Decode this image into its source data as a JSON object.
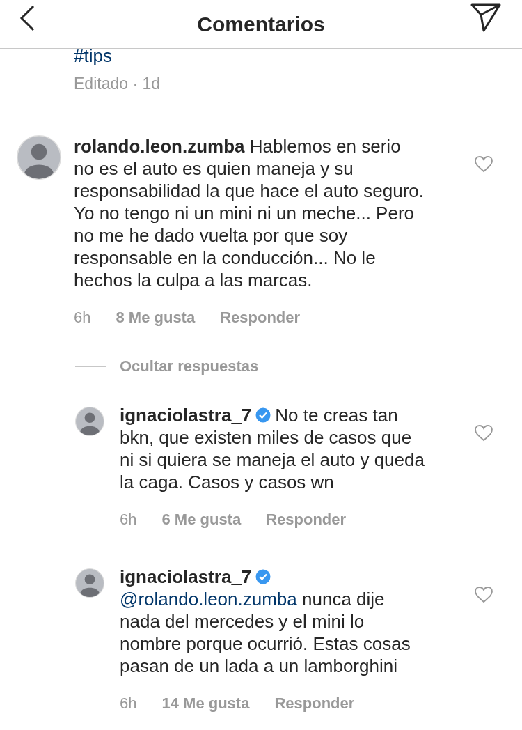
{
  "header": {
    "title": "Comentarios"
  },
  "caption": {
    "tag": "#tips",
    "meta": "Editado · 1d"
  },
  "comment": {
    "username": "rolando.leon.zumba",
    "verified": false,
    "text": "Hablemos en serio no es el auto es quien maneja y su responsabilidad la que hace el auto seguro. Yo no tengo ni un mini ni un meche... Pero no me he dado vuelta por que soy responsable en la conducción... No le hechos la culpa a las marcas.",
    "time": "6h",
    "likes": "8 Me gusta",
    "reply": "Responder",
    "liked": false
  },
  "toggle": "Ocultar respuestas",
  "replies": [
    {
      "username": "ignaciolastra_7",
      "verified": true,
      "text": "No te creas tan bkn, que existen miles de casos que ni si quiera se maneja el auto y queda la caga. Casos y casos wn",
      "time": "6h",
      "likes": "6 Me gusta",
      "reply": "Responder",
      "liked": false
    },
    {
      "username": "ignaciolastra_7",
      "verified": true,
      "mention": "@rolando.leon.zumba",
      "text": "nunca dije nada del mercedes y el mini lo nombre porque ocurrió. Estas cosas pasan de un lada a un lamborghini",
      "time": "6h",
      "likes": "14 Me gusta",
      "reply": "Responder",
      "liked": false
    }
  ]
}
